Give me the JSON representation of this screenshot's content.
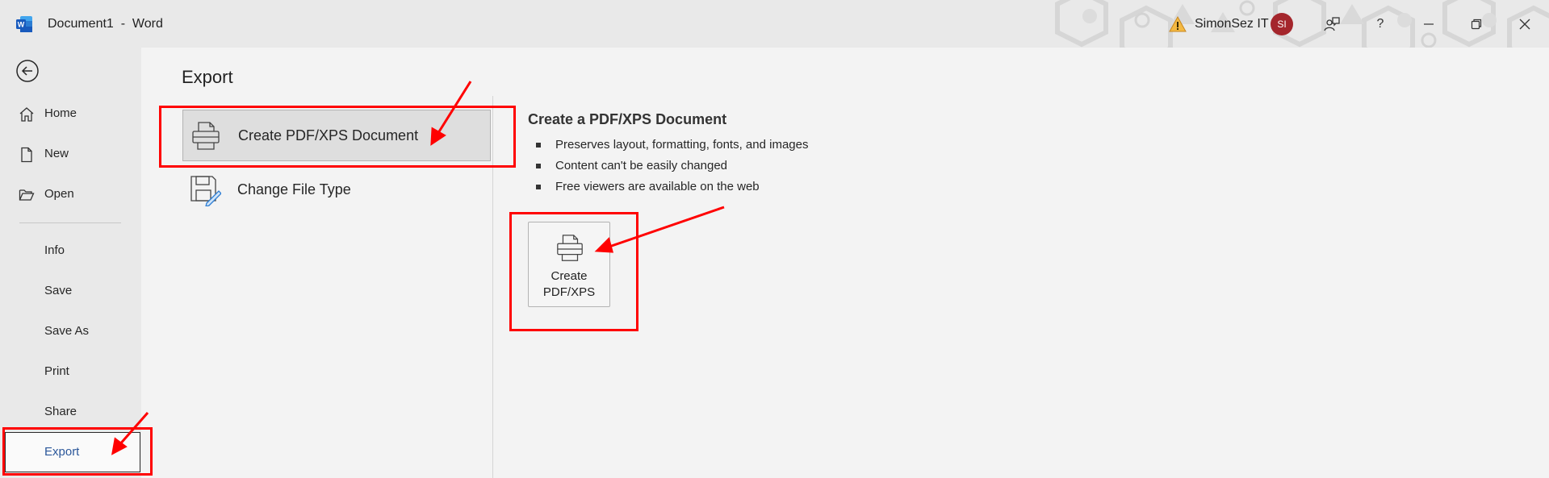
{
  "titlebar": {
    "app_icon": "word-logo-icon",
    "document_title": "Document1  -  Word",
    "account_name": "SimonSez IT",
    "avatar_initials": "SI",
    "warning_icon": "warning-icon",
    "buttons": {
      "coauthor": "coauthor-icon",
      "help": "?",
      "minimize": "minimize-icon",
      "restore": "restore-icon",
      "close": "close-icon"
    }
  },
  "nav": {
    "back_icon": "back-arrow-icon",
    "items": [
      {
        "label": "Home",
        "icon": "home-icon"
      },
      {
        "label": "New",
        "icon": "new-document-icon"
      },
      {
        "label": "Open",
        "icon": "open-folder-icon"
      },
      {
        "label": "Info"
      },
      {
        "label": "Save"
      },
      {
        "label": "Save As"
      },
      {
        "label": "Print"
      },
      {
        "label": "Share"
      },
      {
        "label": "Export",
        "selected": true
      }
    ]
  },
  "main": {
    "title": "Export",
    "options": [
      {
        "label": "Create PDF/XPS Document",
        "icon": "pdf-document-icon",
        "active": true
      },
      {
        "label": "Change File Type",
        "icon": "change-file-type-icon"
      }
    ],
    "detail": {
      "title": "Create a PDF/XPS Document",
      "bullets": [
        "Preserves layout, formatting, fonts, and images",
        "Content can't be easily changed",
        "Free viewers are available on the web"
      ],
      "button_label": "Create\nPDF/XPS"
    }
  },
  "colors": {
    "accent": "#2b579a",
    "annotation": "#ff0000",
    "avatar": "#a4262c"
  }
}
